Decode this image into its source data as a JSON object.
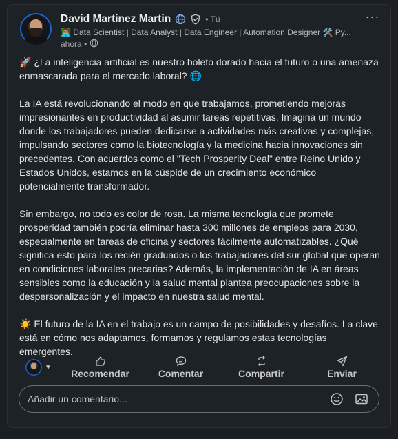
{
  "post": {
    "author": {
      "name": "David Martinez Martin",
      "degree": "• Tú",
      "headline": "👨🏽‍💻 Data Scientist | Data Analyst | Data Engineer | Automation Designer 🛠️ Py...",
      "time": "ahora •"
    },
    "body": {
      "p1": "🚀 ¿La inteligencia artificial es nuestro boleto dorado hacia el futuro o una amenaza enmascarada para el mercado laboral? 🌐",
      "p2": "La IA está revolucionando el modo en que trabajamos, prometiendo mejoras impresionantes en productividad al asumir tareas repetitivas. Imagina un mundo donde los trabajadores pueden dedicarse a actividades más creativas y complejas, impulsando sectores como la biotecnología y la medicina hacia innovaciones sin precedentes. Con acuerdos como el \"Tech Prosperity Deal\" entre Reino Unido y Estados Unidos, estamos en la cúspide de un crecimiento económico potencialmente transformador.",
      "p3": "Sin embargo, no todo es color de rosa. La misma tecnología que promete prosperidad también podría eliminar hasta 300 millones de empleos para 2030, especialmente en tareas de oficina y sectores fácilmente automatizables. ¿Qué significa esto para los recién graduados o los trabajadores del sur global que operan en condiciones laborales precarias? Además, la implementación de IA en áreas sensibles como la educación y la salud mental plantea preocupaciones sobre la despersonalización y el impacto en nuestra salud mental.",
      "p4": "☀️ El futuro de la IA en el trabajo es un campo de posibilidades y desafíos. La clave está en cómo nos adaptamos, formamos y regulamos estas tecnologías emergentes."
    },
    "actions": {
      "recommend": "Recomendar",
      "comment": "Comentar",
      "share": "Compartir",
      "send": "Enviar"
    },
    "comment_box": {
      "placeholder": "Añadir un comentario..."
    }
  },
  "icons": {
    "globe": "globe-icon",
    "verified": "verified-icon",
    "more": "more-icon",
    "like": "like-icon",
    "comment": "comment-icon",
    "repost": "repost-icon",
    "send": "send-icon",
    "emoji": "emoji-icon",
    "image": "image-icon"
  },
  "colors": {
    "background": "#1b1f23",
    "card": "#1d2226",
    "accent": "#1a63d1",
    "text": "#e4e4e4"
  }
}
